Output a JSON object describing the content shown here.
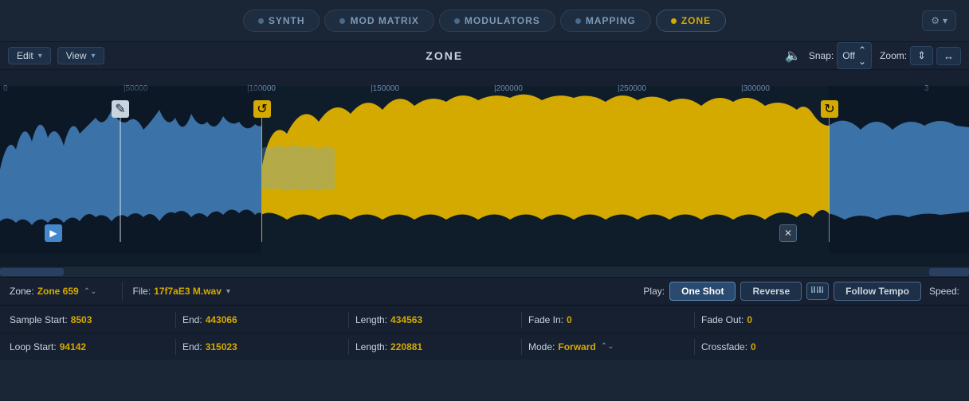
{
  "nav": {
    "tabs": [
      {
        "id": "synth",
        "label": "SYNTH",
        "active": false
      },
      {
        "id": "mod-matrix",
        "label": "MOD MATRIX",
        "active": false
      },
      {
        "id": "modulators",
        "label": "MODULATORS",
        "active": false
      },
      {
        "id": "mapping",
        "label": "MAPPING",
        "active": false
      },
      {
        "id": "zone",
        "label": "ZONE",
        "active": true
      }
    ],
    "settings_label": "⚙"
  },
  "toolbar": {
    "edit_label": "Edit",
    "view_label": "View",
    "zone_title": "ZONE",
    "snap_label": "Snap:",
    "snap_value": "Off",
    "zoom_label": "Zoom:",
    "chevron_down": "▾"
  },
  "waveform": {
    "ruler_marks": [
      "0",
      "50000",
      "100000",
      "150000",
      "200000",
      "250000",
      "300000",
      "3"
    ]
  },
  "info_bar": {
    "zone_label": "Zone:",
    "zone_value": "Zone 659",
    "file_label": "File:",
    "file_value": "17f7aE3 M.wav",
    "play_label": "Play:",
    "one_shot_label": "One Shot",
    "reverse_label": "Reverse",
    "follow_tempo_label": "Follow Tempo",
    "speed_label": "Speed:"
  },
  "row1": {
    "sample_start_label": "Sample Start:",
    "sample_start_value": "8503",
    "end_label": "End:",
    "end_value": "443066",
    "length_label": "Length:",
    "length_value": "434563",
    "fade_in_label": "Fade In:",
    "fade_in_value": "0",
    "fade_out_label": "Fade Out:",
    "fade_out_value": "0"
  },
  "row2": {
    "loop_start_label": "Loop Start:",
    "loop_start_value": "94142",
    "end_label": "End:",
    "end_value": "315023",
    "length_label": "Length:",
    "length_value": "220881",
    "mode_label": "Mode:",
    "mode_value": "Forward",
    "crossfade_label": "Crossfade:",
    "crossfade_value": "0"
  }
}
